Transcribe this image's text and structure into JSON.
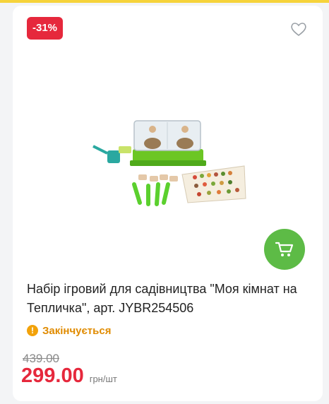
{
  "badge": {
    "discount": "-31%"
  },
  "icons": {
    "favorite": "heart-outline-icon",
    "cart": "shopping-cart-icon",
    "status": "exclamation-icon"
  },
  "product": {
    "title": "Набір ігровий для садівництва \"Моя кімнат на Тепличка\", арт. JYBR254506",
    "status": "Закінчується",
    "old_price": "439.00",
    "price": "299.00",
    "unit": "грн/шт"
  },
  "colors": {
    "discount": "#e6283c",
    "cart": "#5dbb46",
    "status": "#e08b00",
    "accent_strip": "#f6d33b"
  }
}
